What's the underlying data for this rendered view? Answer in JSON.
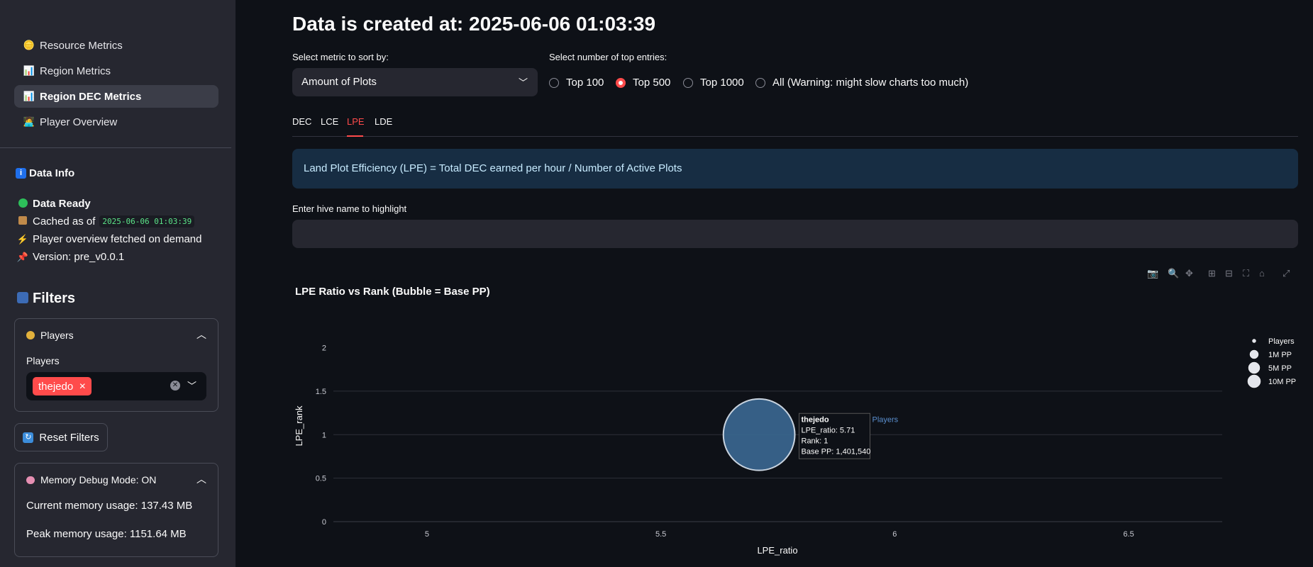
{
  "sidebar": {
    "nav": [
      {
        "icon": "🪙",
        "label": "Resource Metrics"
      },
      {
        "icon": "📊",
        "label": "Region Metrics"
      },
      {
        "icon": "📊",
        "label": "Region DEC Metrics"
      },
      {
        "icon": "🧑‍💻",
        "label": "Player Overview"
      }
    ],
    "data_info": {
      "heading": "Data Info",
      "ready": "Data Ready",
      "cached_label": "Cached as of",
      "cached_value": "2025-06-06 01:03:39",
      "fetch_note": "Player overview fetched on demand",
      "version": "Version: pre_v0.0.1"
    },
    "filters": {
      "heading": "Filters",
      "players_panel_title": "Players",
      "players_label": "Players",
      "selected_player": "thejedo",
      "reset_button": "Reset Filters"
    },
    "memory": {
      "title": "Memory Debug Mode: ON",
      "current": "Current memory usage: 137.43 MB",
      "peak": "Peak memory usage: 1151.64 MB"
    }
  },
  "main": {
    "title": "Data is created at: 2025-06-06 01:03:39",
    "sort_label": "Select metric to sort by:",
    "sort_value": "Amount of Plots",
    "top_label": "Select number of top entries:",
    "top_options": [
      "Top 100",
      "Top 500",
      "Top 1000",
      "All (Warning: might slow charts too much)"
    ],
    "top_selected": "Top 500",
    "tabs": [
      "DEC",
      "LCE",
      "LPE",
      "LDE"
    ],
    "active_tab": "LPE",
    "info_text": "Land Plot Efficiency (LPE) = Total DEC earned per hour / Number of Active Plots",
    "hive_label": "Enter hive name to highlight",
    "hive_value": ""
  },
  "chart_data": {
    "type": "scatter",
    "title": "LPE Ratio vs Rank (Bubble = Base PP)",
    "xlabel": "LPE_ratio",
    "ylabel": "LPE_rank",
    "xlim": [
      4.8,
      6.7
    ],
    "ylim": [
      0,
      2.2
    ],
    "x_ticks": [
      "5",
      "5.5",
      "6",
      "6.5"
    ],
    "y_ticks": [
      "0",
      "0.5",
      "1",
      "1.5",
      "2"
    ],
    "legend": {
      "position": "right",
      "items": [
        "Players",
        "1M PP",
        "5M PP",
        "10M PP"
      ]
    },
    "series": [
      {
        "name": "Players",
        "points": [
          {
            "label": "thejedo",
            "x": 5.71,
            "y": 1,
            "size": 1401540
          }
        ]
      }
    ],
    "hover": {
      "name": "thejedo",
      "lines": [
        "LPE_ratio: 5.71",
        "Rank: 1",
        "Base PP: 1,401,540"
      ],
      "series_label": "Players"
    },
    "grid": true,
    "colors": {
      "bubble": "#3b6892",
      "bubble_edge": "#c8d3df"
    }
  },
  "icons": [
    "camera-icon",
    "zoom-icon",
    "pan-icon",
    "zoom-in-icon",
    "zoom-out-icon",
    "autoscale-icon",
    "home-icon",
    "fullscreen-icon"
  ]
}
